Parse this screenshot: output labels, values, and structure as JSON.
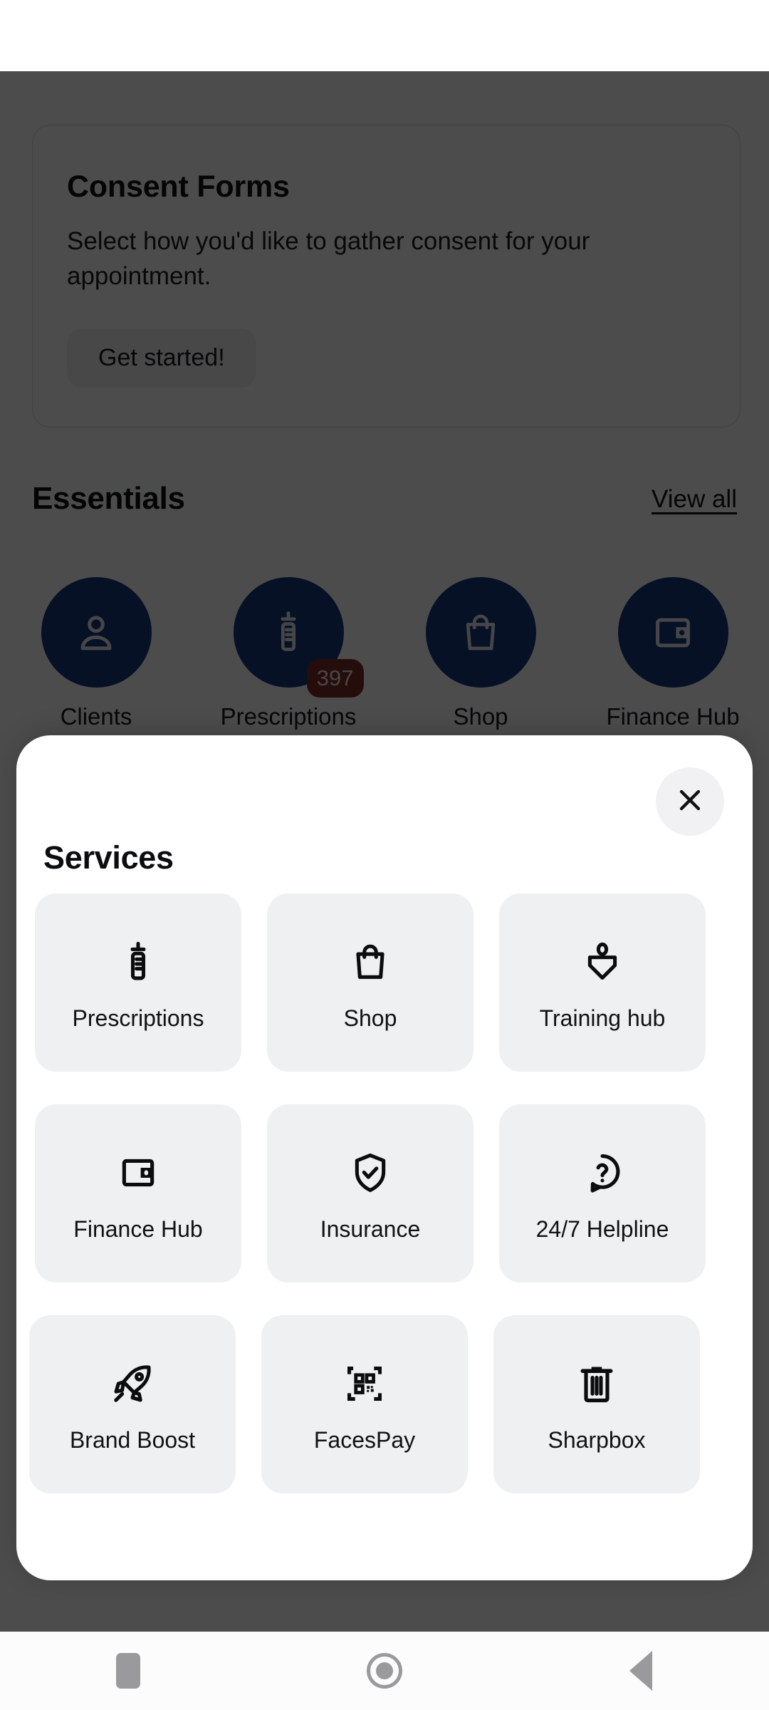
{
  "status_bar": {
    "content": ""
  },
  "app_screen": {
    "consent_card": {
      "title": "Consent Forms",
      "description": "Select how you'd like to gather consent for your appointment.",
      "cta_label": "Get started!"
    },
    "essentials": {
      "heading": "Essentials",
      "view_all_label": "View all",
      "circle_color": "#153a80",
      "badge_color": "#7a2d22",
      "items": [
        {
          "label": "Clients",
          "icon": "person-icon",
          "badge": ""
        },
        {
          "label": "Prescriptions",
          "icon": "syringe-icon",
          "badge": "397"
        },
        {
          "label": "Shop",
          "icon": "shopping-bag-icon",
          "badge": ""
        },
        {
          "label": "Finance Hub",
          "icon": "wallet-icon",
          "badge": ""
        }
      ]
    }
  },
  "services_sheet": {
    "title": "Services",
    "close_icon": "close-icon",
    "tile_background": "#eff0f2",
    "rows": [
      [
        {
          "label": "Prescriptions",
          "icon": "syringe-icon"
        },
        {
          "label": "Shop",
          "icon": "shopping-bag-icon"
        },
        {
          "label": "Training hub",
          "icon": "book-person-icon"
        }
      ],
      [
        {
          "label": "Finance Hub",
          "icon": "wallet-icon"
        },
        {
          "label": "Insurance",
          "icon": "shield-check-icon"
        },
        {
          "label": "24/7 Helpline",
          "icon": "question-chat-icon"
        }
      ],
      [
        {
          "label": "Brand Boost",
          "icon": "rocket-icon"
        },
        {
          "label": "FacesPay",
          "icon": "qr-code-icon"
        },
        {
          "label": "Sharpbox",
          "icon": "trash-bin-icon"
        }
      ]
    ]
  },
  "nav_bar": {
    "buttons": [
      {
        "name": "recents-button",
        "icon": "square-icon"
      },
      {
        "name": "home-button",
        "icon": "circle-icon"
      },
      {
        "name": "back-button",
        "icon": "triangle-left-icon"
      }
    ]
  }
}
